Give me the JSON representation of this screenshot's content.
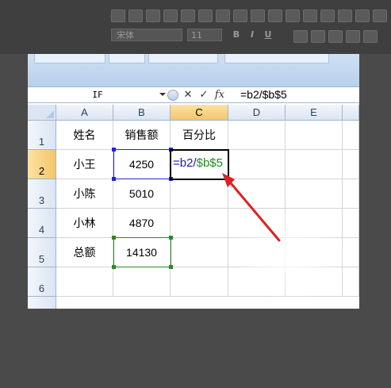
{
  "toolbar": {
    "font_name": "宋体",
    "font_size": "11",
    "bold_label": "B",
    "italic_label": "I",
    "underline_label": "U"
  },
  "formula_bar": {
    "name_box": "IF",
    "cancel_icon": "✕",
    "enter_icon": "✓",
    "fx_label": "fx",
    "formula": "=b2/$b$5"
  },
  "columns": [
    "A",
    "B",
    "C",
    "D",
    "E"
  ],
  "rows": [
    "1",
    "2",
    "3",
    "4",
    "5",
    "6"
  ],
  "cells": {
    "A1": "姓名",
    "B1": "销售额",
    "C1": "百分比",
    "A2": "小王",
    "B2": "4250",
    "A3": "小陈",
    "B3": "5010",
    "A4": "小林",
    "B4": "4870",
    "A5": "总额",
    "B5": "14130"
  },
  "editing": {
    "part1": "=b2/",
    "part2": "$b$5"
  },
  "colors": {
    "ref_blue": "#2222dd",
    "ref_green": "#2a8a2a",
    "arrow_red": "#e02020",
    "active_header": "#f4c66a"
  },
  "icons": [
    "function-icon",
    "cancel-icon",
    "enter-icon",
    "dropdown-arrow-icon",
    "red-arrow-annotation"
  ]
}
